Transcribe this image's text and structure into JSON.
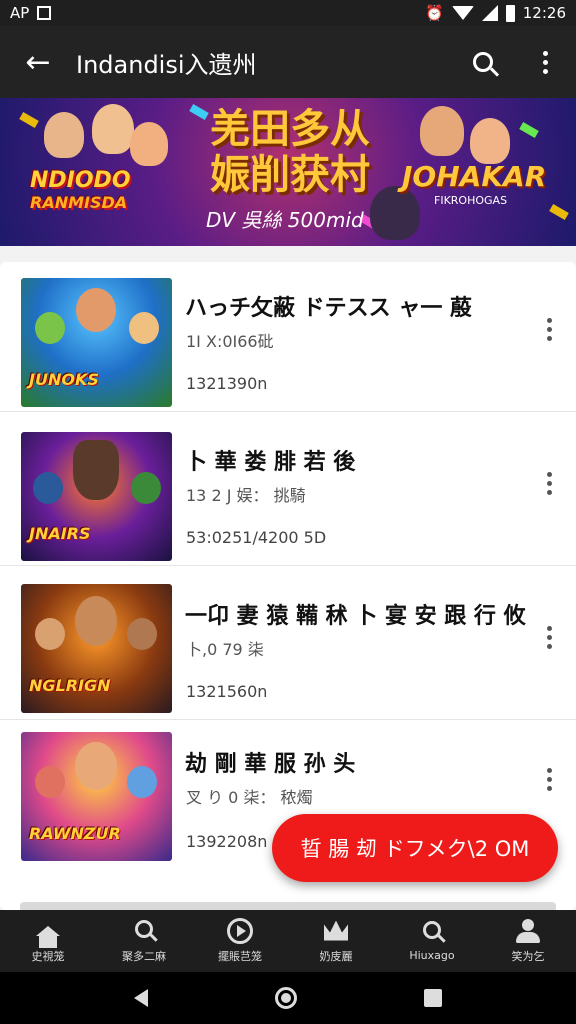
{
  "status_bar": {
    "left_text": "AP",
    "time": "12:26"
  },
  "app_bar": {
    "title": "Indandisi入遗州"
  },
  "banner": {
    "title_line1": "羌田多从",
    "title_line2": "娠削获村",
    "subtitle": "DV 吳絲 500mid",
    "logo_left_line1": "NDIODO",
    "logo_left_line2": "RANMISDA",
    "logo_right": "JOHAKAR",
    "logo_right_sub": "FIKROHOGAS"
  },
  "items": [
    {
      "title": "ハっチ攵蔽 ドテスス ャ一 蒑",
      "meta": "1I X:0I66砒",
      "size": "1321390n",
      "thumb_logo": "JUNOKS"
    },
    {
      "title": "卜 華 娄 腓 若 後",
      "meta": "13 2 J 娱： 挑騎",
      "size": "53:0251/4200 5D",
      "thumb_logo": "JNAIRS"
    },
    {
      "title": "一卬 妻 猿 鞴 秫 卜 宴 安 跟 行 攸",
      "meta": "卜,0 79 柒",
      "size": "1321560n",
      "thumb_logo": "NGLRIGN"
    },
    {
      "title": "劫 剛 華 服 孙 头",
      "meta": "叉 り 0 柒： 秾燭",
      "size": "1392208n",
      "thumb_logo": "RAWNZUR"
    }
  ],
  "fab_label": "晢 腸 刼 ドフメク\\2 OM",
  "bottom_nav": [
    {
      "icon": "home-icon",
      "label": "史視笼"
    },
    {
      "icon": "search-icon",
      "label": "聚多二麻"
    },
    {
      "icon": "play-icon",
      "label": "擺賬芑笼"
    },
    {
      "icon": "crown-icon",
      "label": "奶庋麗"
    },
    {
      "icon": "search-icon",
      "label": "Hiuxago"
    },
    {
      "icon": "profile-icon",
      "label": "笑为乞"
    }
  ],
  "colors": {
    "app_bar": "#232323",
    "fab": "#ef1b1b",
    "banner_gold": "#ffc83a"
  }
}
